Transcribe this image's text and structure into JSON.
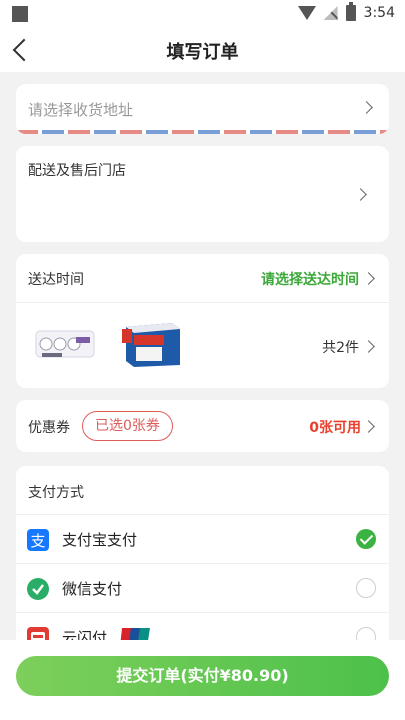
{
  "status_bar": {
    "time": "3:54"
  },
  "nav": {
    "title": "填写订单"
  },
  "address": {
    "placeholder": "请选择收货地址"
  },
  "store": {
    "label": "配送及售后门店"
  },
  "delivery": {
    "label": "送达时间",
    "select_text": "请选择送达时间",
    "items_count": "共2件"
  },
  "coupon": {
    "label": "优惠券",
    "selected": "已选0张券",
    "available": "0张可用"
  },
  "payment": {
    "title": "支付方式",
    "methods": [
      {
        "name": "支付宝支付",
        "icon": "alipay-icon",
        "selected": true
      },
      {
        "name": "微信支付",
        "icon": "wechat-pay-icon",
        "selected": false
      },
      {
        "name": "云闪付",
        "icon": "unionpay-quickpass-icon",
        "selected": false
      }
    ]
  },
  "submit": {
    "label": "提交订单(实付¥80.90)"
  },
  "colors": {
    "accent_green": "#3da83a",
    "accent_red": "#e8402e",
    "button_green": "#5fc74e"
  }
}
